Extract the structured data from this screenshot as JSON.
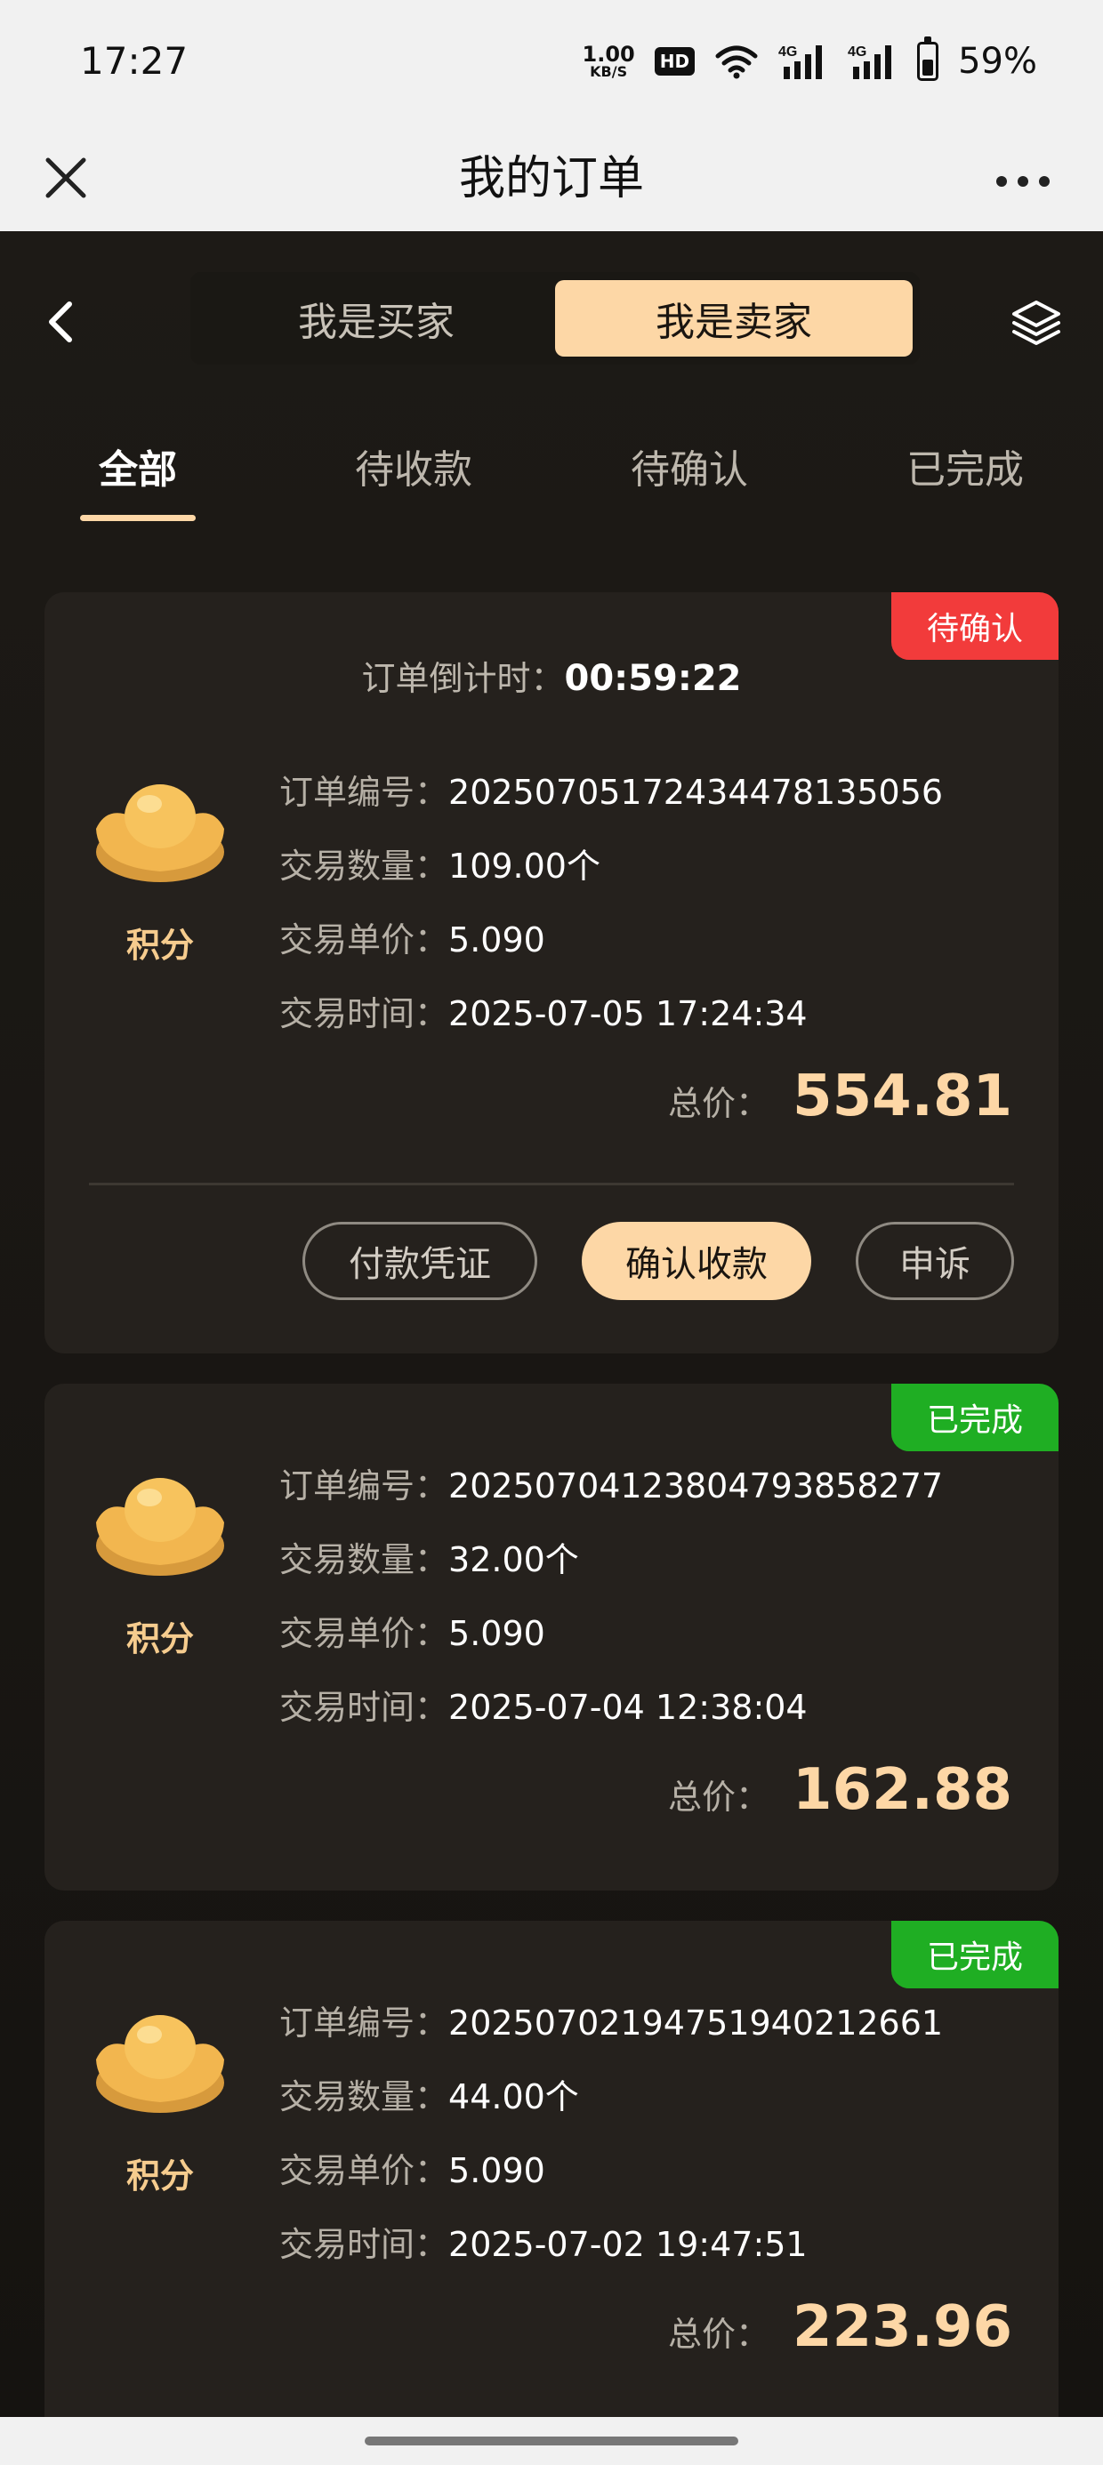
{
  "status_bar": {
    "time": "17:27",
    "net_speed_value": "1.00",
    "net_speed_unit": "KB/S",
    "hd_label": "HD",
    "battery": "59%",
    "icons": [
      "wifi-icon",
      "signal-4g-icon",
      "signal-4g-icon",
      "battery-icon"
    ]
  },
  "title_bar": {
    "title": "我的订单",
    "close_icon": "close-icon",
    "more_icon": "more-icon"
  },
  "header": {
    "roles": [
      {
        "label": "我是买家",
        "active": false
      },
      {
        "label": "我是卖家",
        "active": true
      }
    ],
    "back_icon": "chevron-left-icon",
    "layers_icon": "layers-icon"
  },
  "tabs": [
    {
      "label": "全部",
      "active": true
    },
    {
      "label": "待收款",
      "active": false
    },
    {
      "label": "待确认",
      "active": false
    },
    {
      "label": "已完成",
      "active": false
    }
  ],
  "labels": {
    "order_no": "订单编号：",
    "quantity": "交易数量：",
    "unit_price": "交易单价：",
    "time": "交易时间：",
    "total": "总价：",
    "countdown": "订单倒计时：",
    "item_name": "积分"
  },
  "orders": [
    {
      "status": "待确认",
      "status_color": "#f23b3b",
      "countdown": "00:59:22",
      "order_no": "20250705172434478135056",
      "quantity": "109.00个",
      "unit_price": "5.090",
      "time": "2025-07-05 17:24:34",
      "total": "554.81",
      "actions": [
        "付款凭证",
        "确认收款",
        "申诉"
      ]
    },
    {
      "status": "已完成",
      "status_color": "#1fae23",
      "order_no": "20250704123804793858277",
      "quantity": "32.00个",
      "unit_price": "5.090",
      "time": "2025-07-04 12:38:04",
      "total": "162.88"
    },
    {
      "status": "已完成",
      "status_color": "#1fae23",
      "order_no": "20250702194751940212661",
      "quantity": "44.00个",
      "unit_price": "5.090",
      "time": "2025-07-02 19:47:51",
      "total": "223.96"
    }
  ],
  "colors": {
    "accent": "#fdd7a6",
    "background": "#1d1a16",
    "card": "#25211d"
  }
}
